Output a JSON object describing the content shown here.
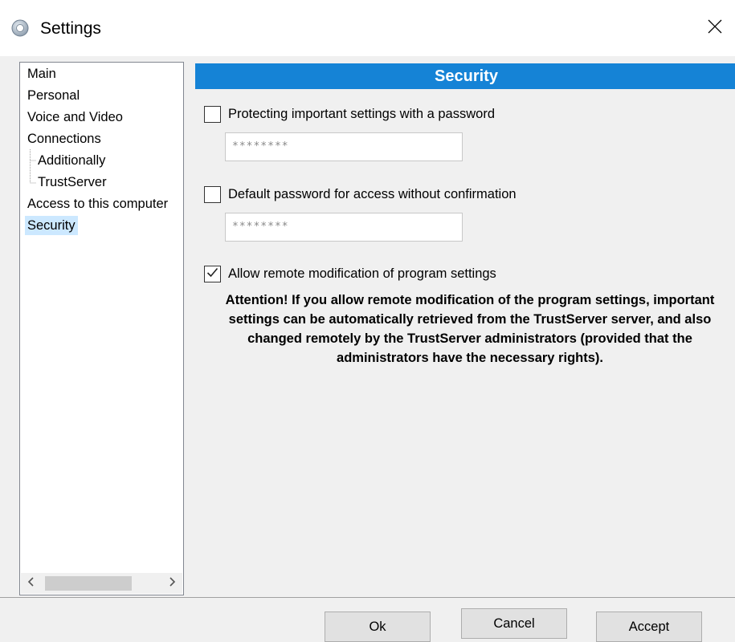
{
  "window": {
    "title": "Settings",
    "icon": "gear-icon",
    "close_icon": "close-icon"
  },
  "nav": {
    "items": [
      {
        "label": "Main",
        "level": 0
      },
      {
        "label": "Personal",
        "level": 0
      },
      {
        "label": "Voice and Video",
        "level": 0
      },
      {
        "label": "Connections",
        "level": 0
      },
      {
        "label": "Additionally",
        "level": 1
      },
      {
        "label": "TrustServer",
        "level": 1
      },
      {
        "label": "Access to this computer",
        "level": 0
      },
      {
        "label": "Security",
        "level": 0,
        "selected": true
      }
    ],
    "scroll_left": "<",
    "scroll_right": ">"
  },
  "section": {
    "title": "Security",
    "header_color": "#1583d6"
  },
  "options": {
    "protect_settings": {
      "label": "Protecting important settings with a password",
      "checked": false,
      "password_value": "********"
    },
    "default_password": {
      "label": "Default password for access without confirmation",
      "checked": false,
      "password_value": "********"
    },
    "allow_remote": {
      "label": "Allow remote modification of program settings",
      "checked": true
    }
  },
  "attention_text": "Attention! If you allow remote modification of the program settings, important settings can be automatically retrieved from the TrustServer server, and also changed remotely by the TrustServer administrators (provided that the administrators have the necessary rights).",
  "buttons": {
    "ok": "Ok",
    "cancel": "Cancel",
    "accept": "Accept"
  }
}
